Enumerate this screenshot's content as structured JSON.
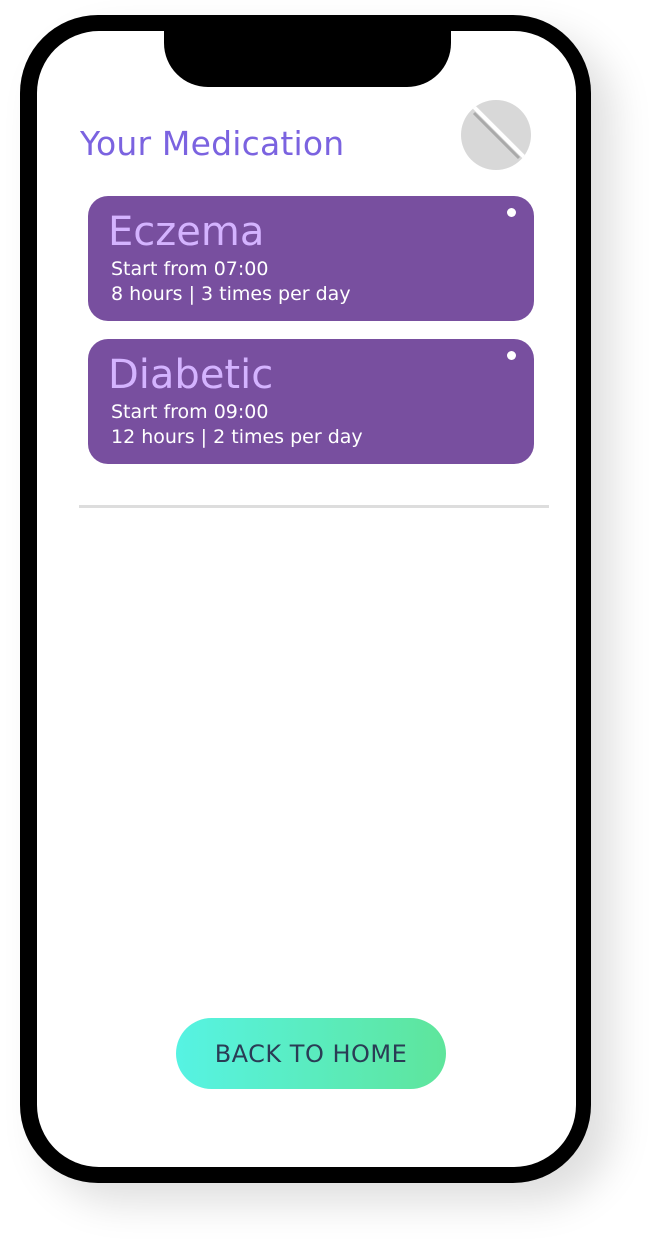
{
  "header": {
    "title": "Your Medication",
    "avatar_icon": "pill-icon"
  },
  "medications": [
    {
      "name": "Eczema",
      "start": "Start from 07:00",
      "frequency": "8 hours | 3 times per day"
    },
    {
      "name": "Diabetic",
      "start": "Start from 09:00",
      "frequency": "12 hours | 2 times per day"
    }
  ],
  "footer": {
    "back_label": "BACK TO HOME"
  },
  "colors": {
    "title": "#7b63e0",
    "card_background": "#784f9f",
    "card_title": "#d4b3ff",
    "button_gradient_start": "#56f3e3",
    "button_gradient_end": "#5ee59b",
    "button_text": "#2a3c55"
  }
}
